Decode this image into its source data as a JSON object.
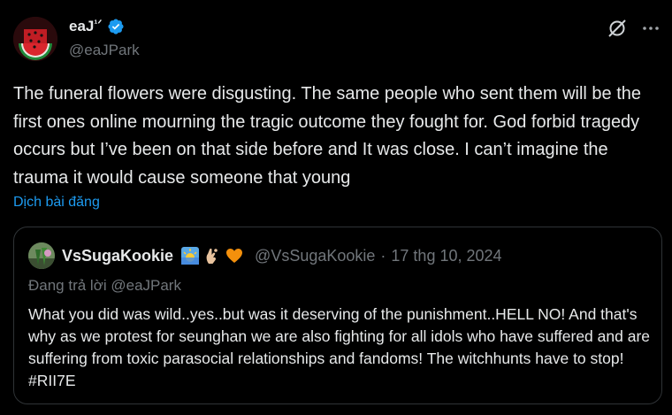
{
  "author": {
    "display_name": "eaJ",
    "display_suffix": "¹ᐟ",
    "handle": "@eaJPark"
  },
  "icons": {
    "verified": "verified-badge-icon",
    "grok": "grok-icon",
    "more": "more-icon"
  },
  "tweet": {
    "text": "The funeral flowers were disgusting. The same people who sent them will be the first ones online mourning the tragic outcome they fought for. God forbid tragedy occurs but I’ve been on that side before and It was close. I can’t imagine the trauma it would cause someone that young",
    "translate_label": "Dịch bài đăng"
  },
  "quote": {
    "display_name": "VsSugaKookie",
    "emojis": [
      "sunrise-emoji",
      "pinching-hand-emoji",
      "orange-heart-emoji"
    ],
    "handle": "@VsSugaKookie",
    "separator": "·",
    "date": "17 thg 10, 2024",
    "replying_to": "Đang trả lời @eaJPark",
    "text": "What you did was wild..yes..but was it deserving of the punishment..HELL NO! And that's why as we protest for seunghan we are also fighting for all idols who have suffered and are suffering from toxic parasocial relationships and fandoms! The witchhunts have to stop! #RII7E"
  },
  "colors": {
    "background": "#000000",
    "text": "#e7e9ea",
    "secondary": "#71767b",
    "link": "#1d9bf0",
    "border": "#2f3336"
  }
}
